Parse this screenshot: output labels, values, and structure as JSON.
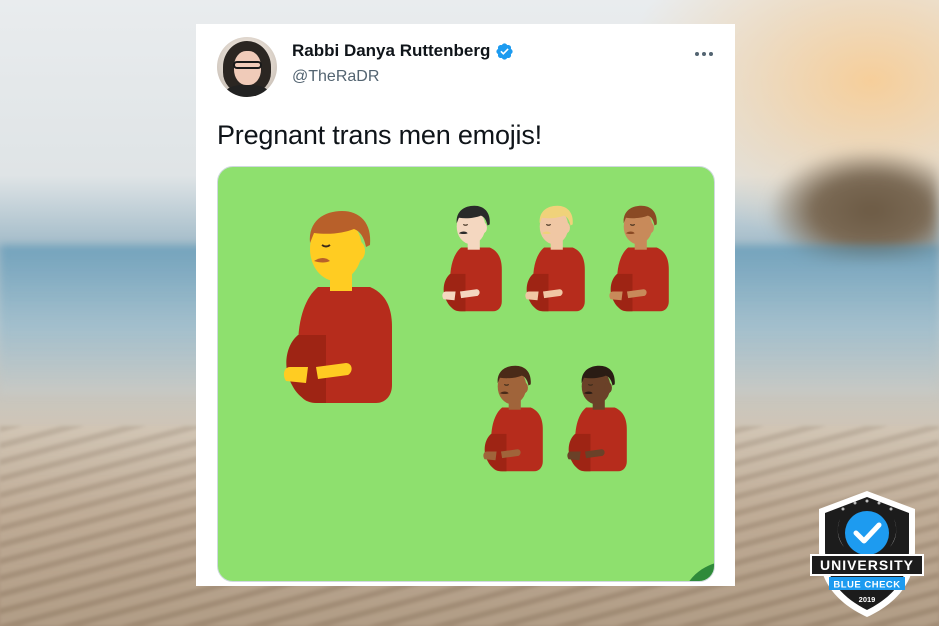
{
  "tweet": {
    "display_name": "Rabbi Danya Ruttenberg",
    "handle": "@TheRaDR",
    "text": "Pregnant trans men emojis!"
  },
  "media": {
    "background_color": "#8ee06e",
    "skin_tones": [
      "#ffcc22",
      "#f4d7c0",
      "#f0c7a4",
      "#c88a5a",
      "#a0643a",
      "#6a4128"
    ],
    "hair_colors": [
      "#b8602a",
      "#2a2a2a",
      "#f0d27a",
      "#8a4a24",
      "#4a2a18",
      "#2a1c14"
    ]
  },
  "badge": {
    "line1": "UNIVERSITY",
    "line2": "BLUE CHECK",
    "year": "2019"
  },
  "colors": {
    "verified_blue": "#1d9bf0",
    "text_primary": "#0f1419",
    "text_secondary": "#536471",
    "shirt_red": "#b62c1c"
  }
}
